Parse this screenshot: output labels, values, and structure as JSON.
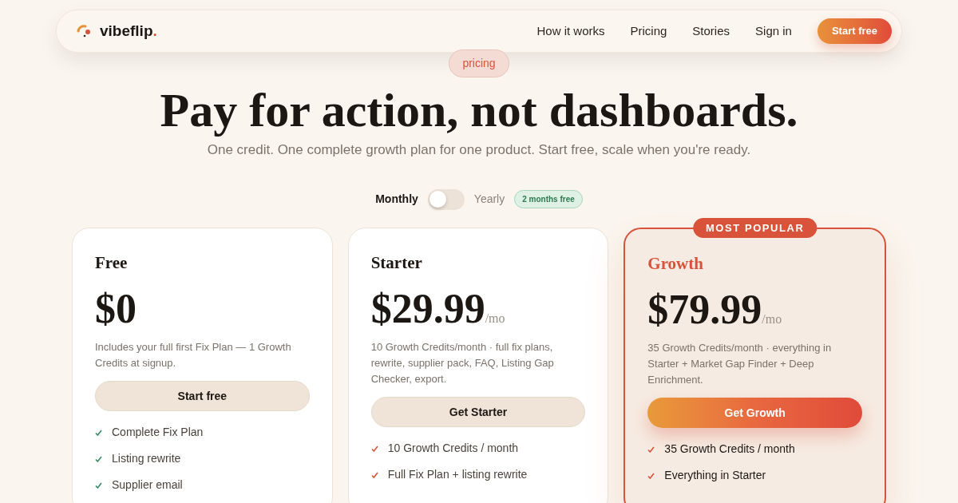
{
  "nav": {
    "brand": "vibeflip",
    "brand_dot": ".",
    "links": [
      "How it works",
      "Pricing",
      "Stories",
      "Sign in"
    ],
    "cta": "Start free"
  },
  "hero": {
    "badge": "pricing",
    "title": "Pay for action, not dashboards.",
    "subtitle": "One credit. One complete growth plan for one product. Start free, scale when you're ready."
  },
  "billing": {
    "monthly": "Monthly",
    "yearly": "Yearly",
    "on": false,
    "promo": "2 months free"
  },
  "plans": [
    {
      "name": "Free",
      "price": "$0",
      "featured": false,
      "description": "Includes your full first Fix Plan — 1 Growth Credits at signup.",
      "button": "Start free",
      "color": "#3a8a63",
      "features": [
        "Complete Fix Plan",
        "Listing rewrite",
        "Supplier email"
      ]
    },
    {
      "name": "Starter",
      "price": "$29.99",
      "period": "/mo",
      "featured": false,
      "description": "10 Growth Credits/month · full fix plans, rewrite, supplier pack, FAQ, Listing Gap Checker, export.",
      "button": "Get Starter",
      "color": "#d9533a",
      "features": [
        "10 Growth Credits / month",
        "Full Fix Plan + listing rewrite"
      ]
    },
    {
      "name": "Growth",
      "price": "$79.99",
      "period": "/mo",
      "featured": true,
      "ribbon": "MOST POPULAR",
      "description": "35 Growth Credits/month · everything in Starter + Market Gap Finder + Deep Enrichment.",
      "button": "Get Growth",
      "color": "#d9533a",
      "features": [
        "35 Growth Credits / month",
        "Everything in Starter"
      ]
    }
  ]
}
